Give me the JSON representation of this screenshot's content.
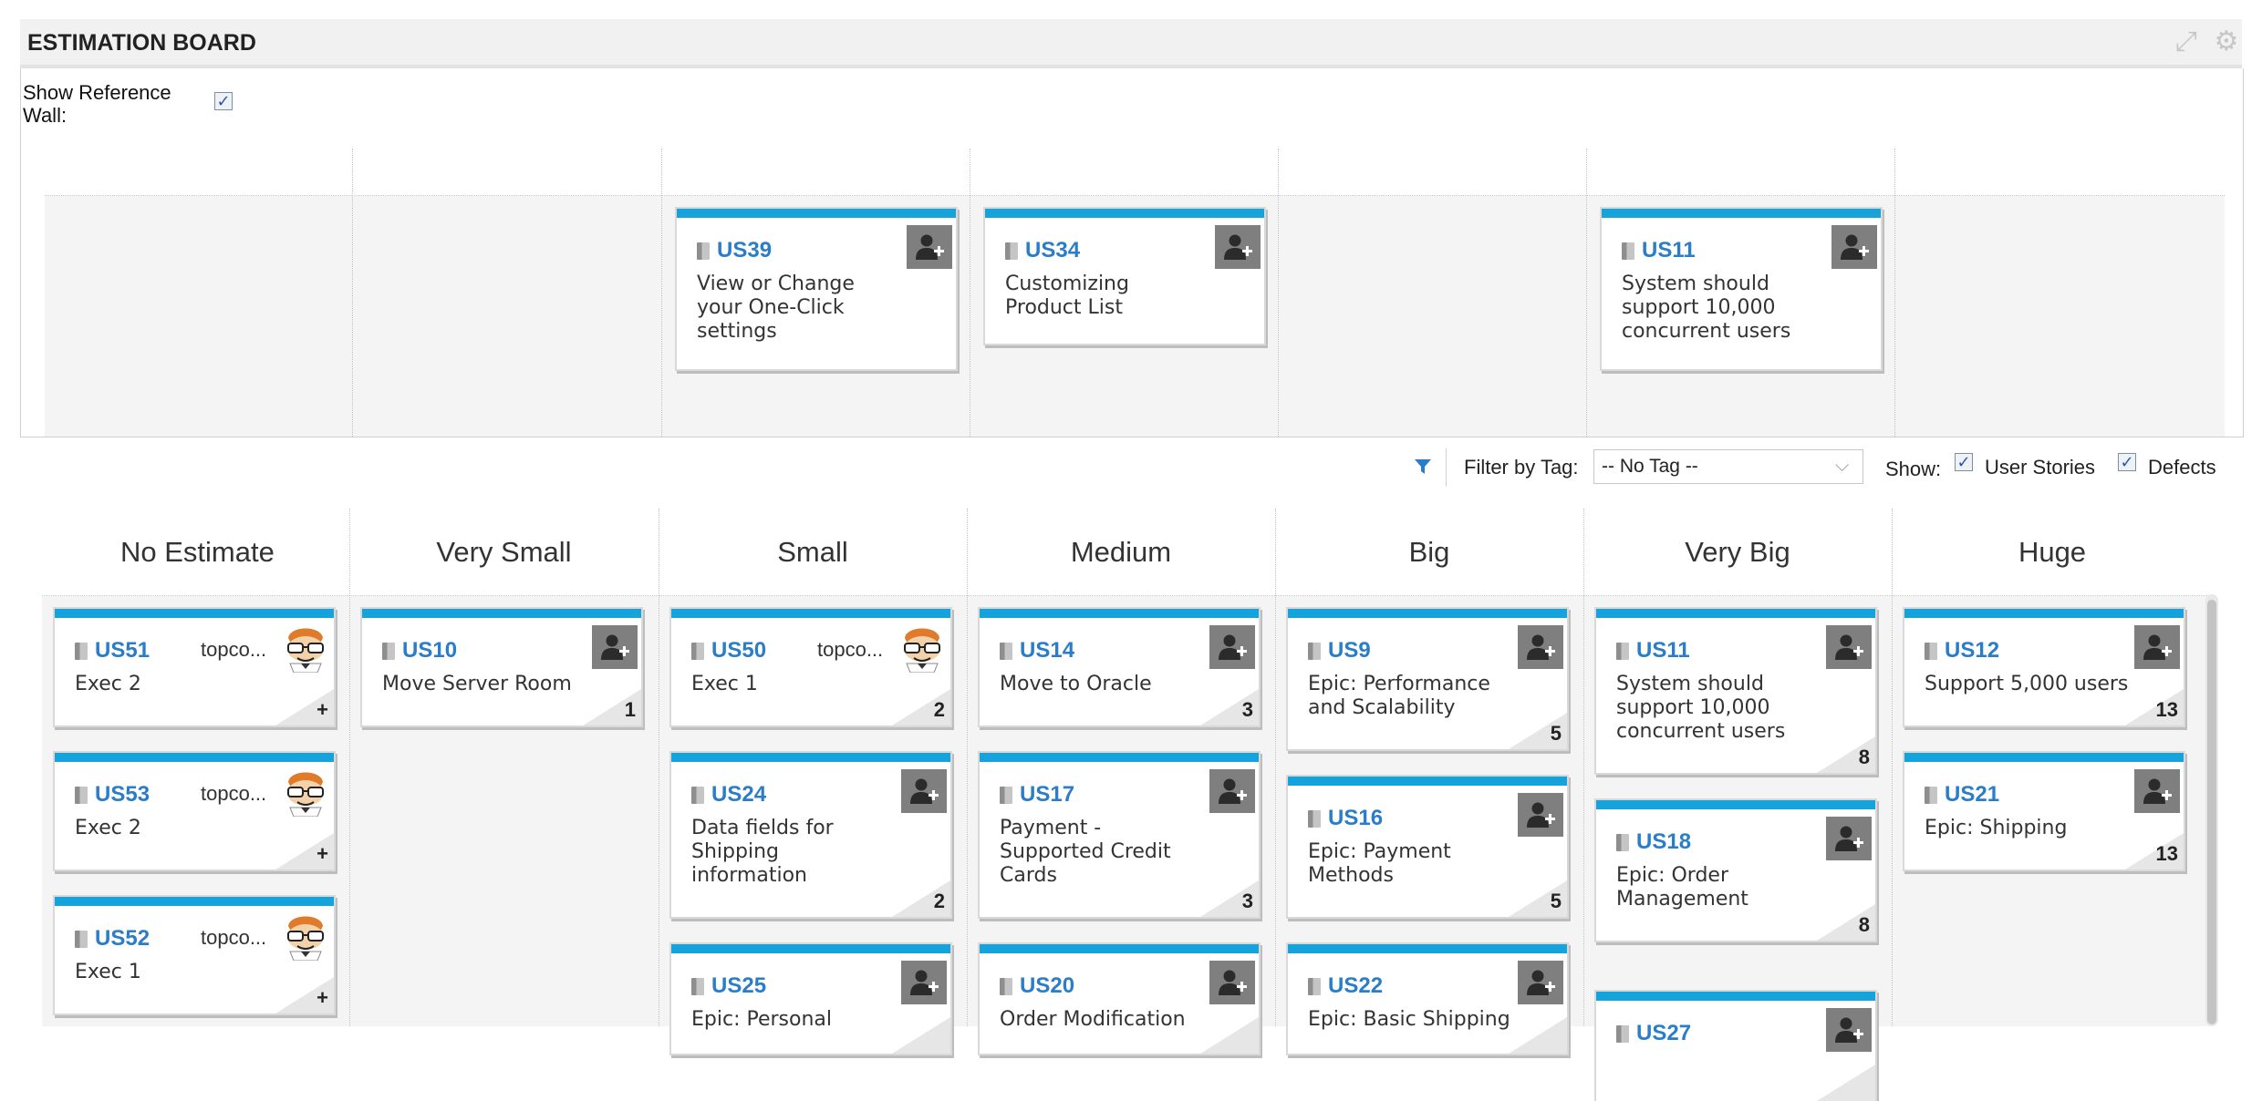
{
  "header": {
    "title": "ESTIMATION BOARD",
    "icons": [
      "expand-icon",
      "gear-icon"
    ]
  },
  "reference": {
    "label": "Show Reference Wall:",
    "checked": true,
    "cards": [
      {
        "id": "US39",
        "title": [
          "View or Change",
          "your One-Click",
          "settings"
        ]
      },
      {
        "id": "US34",
        "title": [
          "Customizing",
          "Product List"
        ]
      },
      {
        "id": "US11",
        "title": [
          "System should",
          "support 10,000",
          "concurrent users"
        ]
      }
    ]
  },
  "filter": {
    "label": "Filter by Tag:",
    "tag_value": "-- No Tag --",
    "show_label": "Show:",
    "user_stories_label": "User Stories",
    "user_stories_checked": true,
    "defects_label": "Defects",
    "defects_checked": true
  },
  "columns": [
    {
      "name": "No Estimate",
      "cards": [
        {
          "id": "US51",
          "owner": "topco...",
          "title": [
            "Exec 2"
          ],
          "estimate": "+"
        },
        {
          "id": "US53",
          "owner": "topco...",
          "title": [
            "Exec 2"
          ],
          "estimate": "+"
        },
        {
          "id": "US52",
          "owner": "topco...",
          "title": [
            "Exec 1"
          ],
          "estimate": "+"
        }
      ]
    },
    {
      "name": "Very Small",
      "cards": [
        {
          "id": "US10",
          "title": [
            "Move Server Room"
          ],
          "estimate": "1"
        }
      ]
    },
    {
      "name": "Small",
      "cards": [
        {
          "id": "US50",
          "owner": "topco...",
          "title": [
            "Exec 1"
          ],
          "estimate": "2"
        },
        {
          "id": "US24",
          "title": [
            "Data fields for",
            "Shipping",
            "information"
          ],
          "estimate": "2"
        },
        {
          "id": "US25",
          "title": [
            "Epic: Personal"
          ],
          "estimate": ""
        }
      ]
    },
    {
      "name": "Medium",
      "cards": [
        {
          "id": "US14",
          "title": [
            "Move to Oracle"
          ],
          "estimate": "3"
        },
        {
          "id": "US17",
          "title": [
            "Payment -",
            "Supported Credit",
            "Cards"
          ],
          "estimate": "3"
        },
        {
          "id": "US20",
          "title": [
            "Order Modification"
          ],
          "estimate": ""
        }
      ]
    },
    {
      "name": "Big",
      "cards": [
        {
          "id": "US9",
          "title": [
            "Epic: Performance",
            "and Scalability"
          ],
          "estimate": "5"
        },
        {
          "id": "US16",
          "title": [
            "Epic: Payment",
            "Methods"
          ],
          "estimate": "5"
        },
        {
          "id": "US22",
          "title": [
            "Epic: Basic Shipping"
          ],
          "estimate": ""
        }
      ]
    },
    {
      "name": "Very Big",
      "cards": [
        {
          "id": "US11",
          "title": [
            "System should",
            "support 10,000",
            "concurrent users"
          ],
          "estimate": "8"
        },
        {
          "id": "US18",
          "title": [
            "Epic: Order",
            "Management"
          ],
          "estimate": "8"
        },
        {
          "id": "US27",
          "title": [],
          "estimate": ""
        }
      ]
    },
    {
      "name": "Huge",
      "cards": [
        {
          "id": "US12",
          "title": [
            "Support 5,000 users"
          ],
          "estimate": "13"
        },
        {
          "id": "US21",
          "title": [
            "Epic: Shipping"
          ],
          "estimate": "13"
        }
      ]
    }
  ],
  "colors": {
    "card_accent": "#16a3dc",
    "link": "#2a7dc9",
    "owner_button": "#7f7f7f"
  }
}
